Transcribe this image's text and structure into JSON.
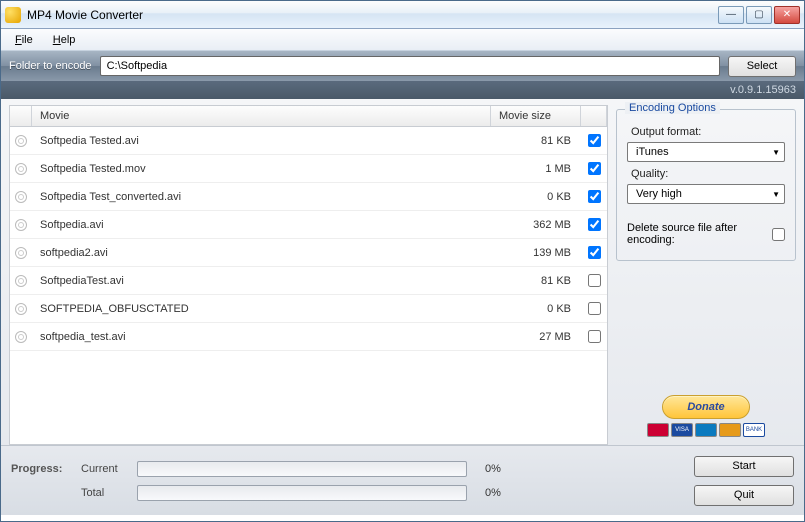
{
  "window": {
    "title": "MP4 Movie Converter"
  },
  "menu": {
    "file": "File",
    "help": "Help"
  },
  "folder": {
    "label": "Folder to encode",
    "path": "C:\\Softpedia",
    "select": "Select"
  },
  "version": "v.0.9.1.15963",
  "columns": {
    "movie": "Movie",
    "size": "Movie size"
  },
  "files": [
    {
      "name": "Softpedia Tested.avi",
      "size": "81 KB",
      "checked": true
    },
    {
      "name": "Softpedia Tested.mov",
      "size": "1 MB",
      "checked": true
    },
    {
      "name": "Softpedia Test_converted.avi",
      "size": "0 KB",
      "checked": true
    },
    {
      "name": "Softpedia.avi",
      "size": "362 MB",
      "checked": true
    },
    {
      "name": "softpedia2.avi",
      "size": "139 MB",
      "checked": true
    },
    {
      "name": "SoftpediaTest.avi",
      "size": "81 KB",
      "checked": false
    },
    {
      "name": "SOFTPEDIA_OBFUSCTATED",
      "size": "0 KB",
      "checked": false
    },
    {
      "name": "softpedia_test.avi",
      "size": "27 MB",
      "checked": false
    }
  ],
  "options": {
    "legend": "Encoding Options",
    "output_label": "Output format:",
    "output_value": "iTunes",
    "quality_label": "Quality:",
    "quality_value": "Very high",
    "delete_label": "Delete source file after encoding:",
    "delete_checked": false
  },
  "donate": {
    "label": "Donate"
  },
  "progress": {
    "label": "Progress:",
    "current_label": "Current",
    "current_pct": "0%",
    "total_label": "Total",
    "total_pct": "0%"
  },
  "buttons": {
    "start": "Start",
    "quit": "Quit"
  }
}
